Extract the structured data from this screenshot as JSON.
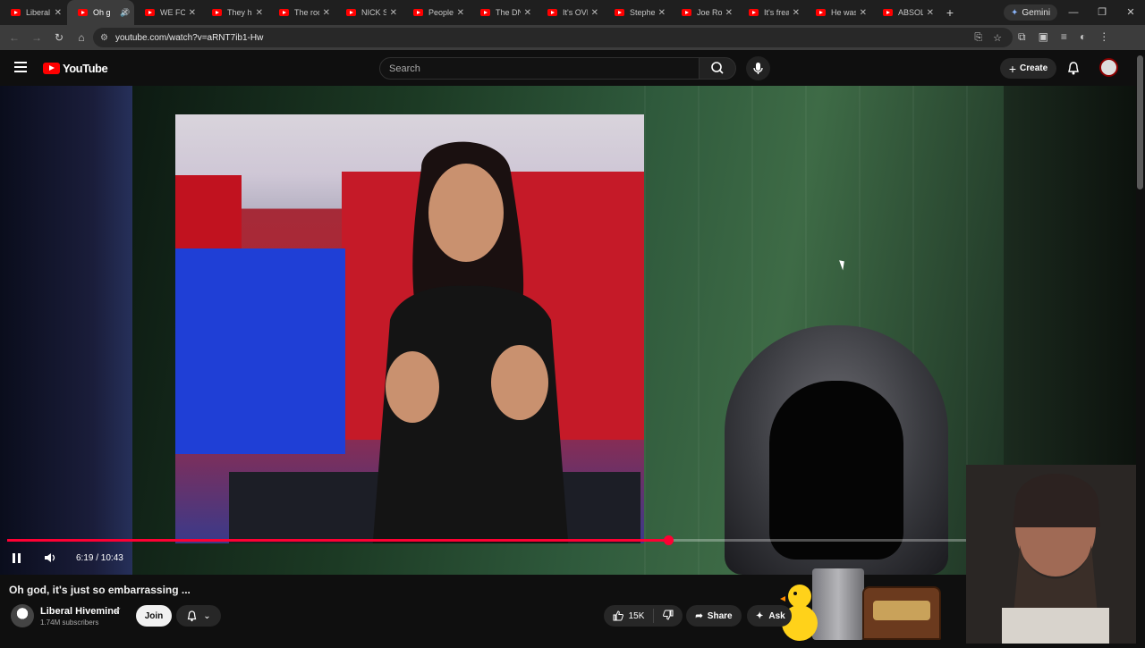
{
  "browser": {
    "tabs": [
      {
        "label": "Liberal H"
      },
      {
        "label": "Oh g",
        "active": true,
        "audio": true
      },
      {
        "label": "WE FOU"
      },
      {
        "label": "They ha"
      },
      {
        "label": "The roo"
      },
      {
        "label": "NICK SH"
      },
      {
        "label": "People"
      },
      {
        "label": "The DN"
      },
      {
        "label": "It's OVE"
      },
      {
        "label": "Stepher"
      },
      {
        "label": "Joe Rog"
      },
      {
        "label": "It's frea"
      },
      {
        "label": "He was"
      },
      {
        "label": "ABSOLU"
      }
    ],
    "gemini_label": "Gemini",
    "url": "youtube.com/watch?v=aRNT7ib1-Hw"
  },
  "youtube": {
    "logo_text": "YouTube",
    "search_placeholder": "Search",
    "create_label": "Create"
  },
  "player": {
    "current_time": "6:19",
    "duration": "10:43",
    "time_display": "6:19 / 10:43",
    "progress_fraction": 0.589
  },
  "video": {
    "title": "Oh god, it's just so embarrassing ...",
    "channel_name": "Liberal Hivemind",
    "subscribers": "1.74M subscribers",
    "join_label": "Join",
    "like_count": "15K",
    "share_label": "Share",
    "ask_label": "Ask"
  },
  "colors": {
    "youtube_red": "#ff0000",
    "progress_red": "#ff0033",
    "background": "#0f0f0f"
  }
}
